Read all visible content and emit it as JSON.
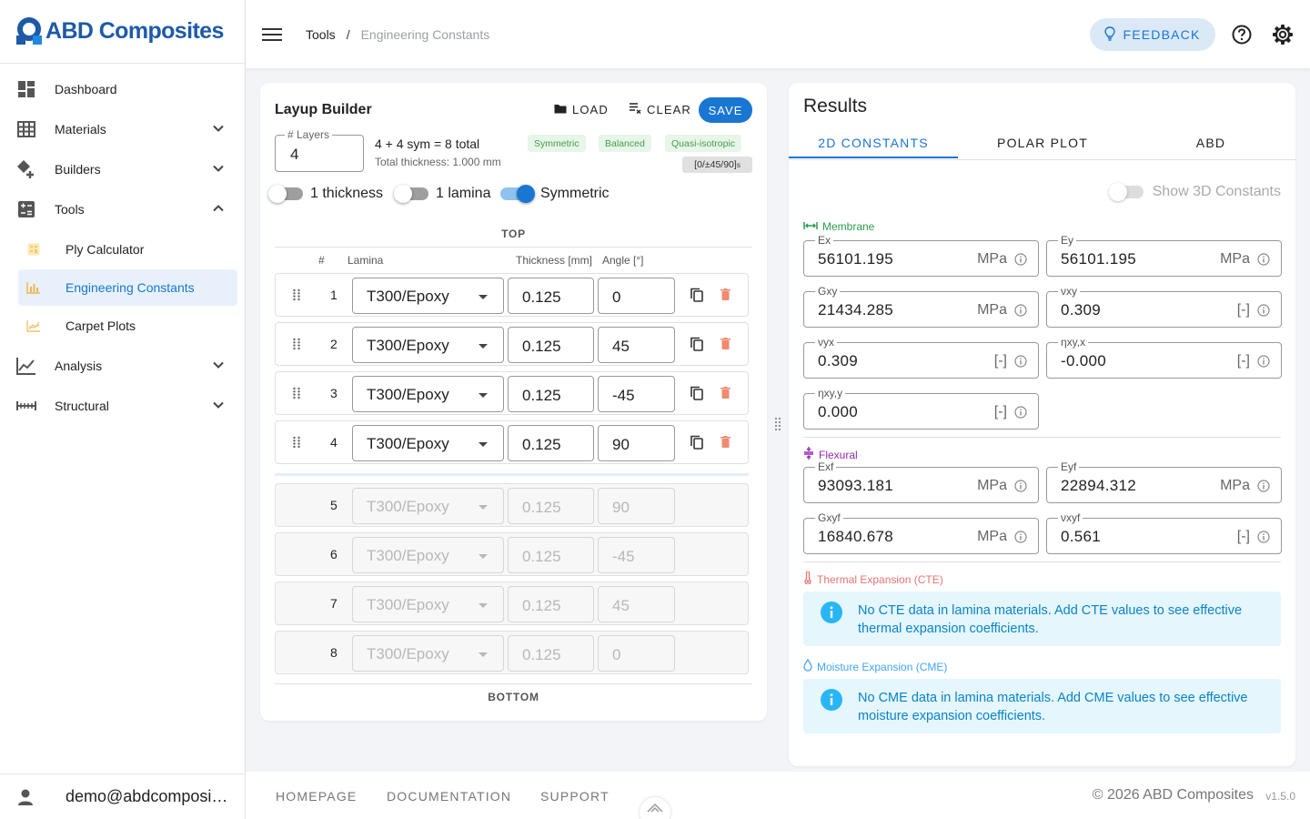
{
  "app": {
    "brand": "ABD Composites"
  },
  "sidebar": {
    "items": [
      {
        "label": "Dashboard",
        "icon": "dashboard-icon"
      },
      {
        "label": "Materials",
        "icon": "grid-table-icon"
      },
      {
        "label": "Builders",
        "icon": "shapes-add-icon"
      },
      {
        "label": "Tools",
        "icon": "calculator-box-icon"
      },
      {
        "label": "Analysis",
        "icon": "line-chart-icon"
      },
      {
        "label": "Structural",
        "icon": "beam-icon"
      }
    ],
    "tools_children": [
      {
        "label": "Ply Calculator",
        "icon": "calculator-icon"
      },
      {
        "label": "Engineering Constants",
        "icon": "bar-chart-icon"
      },
      {
        "label": "Carpet Plots",
        "icon": "carpet-plot-icon"
      }
    ],
    "user_email": "demo@abdcomposites.com"
  },
  "breadcrumb": {
    "root": "Tools",
    "separator": "/",
    "current": "Engineering Constants"
  },
  "topbar": {
    "feedback_label": "FEEDBACK"
  },
  "layup": {
    "title": "Layup Builder",
    "load_label": "LOAD",
    "clear_label": "CLEAR",
    "save_label": "SAVE",
    "layers_label": "# Layers",
    "layers_value": "4",
    "summary": "4 + 4 sym = 8 total",
    "total_thickness": "Total thickness: 1.000 mm",
    "chips": [
      "Symmetric",
      "Balanced",
      "Quasi-isotropic"
    ],
    "code_main": "[0/±45/90]",
    "code_sub": "s",
    "toggles": [
      {
        "label": "1 thickness",
        "on": false
      },
      {
        "label": "1 lamina",
        "on": false
      },
      {
        "label": "Symmetric",
        "on": true
      }
    ],
    "top_label": "TOP",
    "bottom_label": "BOTTOM",
    "col_num": "#",
    "col_lamina": "Lamina",
    "col_thickness": "Thickness [mm]",
    "col_angle": "Angle [°]",
    "rows": [
      {
        "num": "1",
        "lamina": "T300/Epoxy",
        "thickness": "0.125",
        "angle": "0"
      },
      {
        "num": "2",
        "lamina": "T300/Epoxy",
        "thickness": "0.125",
        "angle": "45"
      },
      {
        "num": "3",
        "lamina": "T300/Epoxy",
        "thickness": "0.125",
        "angle": "-45"
      },
      {
        "num": "4",
        "lamina": "T300/Epoxy",
        "thickness": "0.125",
        "angle": "90"
      }
    ],
    "mirror_rows": [
      {
        "num": "5",
        "lamina": "T300/Epoxy",
        "thickness": "0.125",
        "angle": "90"
      },
      {
        "num": "6",
        "lamina": "T300/Epoxy",
        "thickness": "0.125",
        "angle": "-45"
      },
      {
        "num": "7",
        "lamina": "T300/Epoxy",
        "thickness": "0.125",
        "angle": "45"
      },
      {
        "num": "8",
        "lamina": "T300/Epoxy",
        "thickness": "0.125",
        "angle": "0"
      }
    ]
  },
  "results": {
    "title": "Results",
    "tabs": [
      "2D CONSTANTS",
      "POLAR PLOT",
      "ABD"
    ],
    "show3d_label": "Show 3D Constants",
    "membrane_label": "Membrane",
    "membrane": [
      {
        "label": "Ex",
        "value": "56101.195",
        "unit": "MPa"
      },
      {
        "label": "Ey",
        "value": "56101.195",
        "unit": "MPa"
      },
      {
        "label": "Gxy",
        "value": "21434.285",
        "unit": "MPa"
      },
      {
        "label": "νxy",
        "value": "0.309",
        "unit": "[-]"
      },
      {
        "label": "νyx",
        "value": "0.309",
        "unit": "[-]"
      },
      {
        "label": "ηxy,x",
        "value": "-0.000",
        "unit": "[-]"
      },
      {
        "label": "ηxy,y",
        "value": "0.000",
        "unit": "[-]"
      }
    ],
    "flexural_label": "Flexural",
    "flexural": [
      {
        "label": "Exf",
        "value": "93093.181",
        "unit": "MPa"
      },
      {
        "label": "Eyf",
        "value": "22894.312",
        "unit": "MPa"
      },
      {
        "label": "Gxyf",
        "value": "16840.678",
        "unit": "MPa"
      },
      {
        "label": "νxyf",
        "value": "0.561",
        "unit": "[-]"
      }
    ],
    "cte_label": "Thermal Expansion (CTE)",
    "cte_message": "No CTE data in lamina materials. Add CTE values to see effective thermal expansion coefficients.",
    "cme_label": "Moisture Expansion (CME)",
    "cme_message": "No CME data in lamina materials. Add CME values to see effective moisture expansion coefficients."
  },
  "footer": {
    "links": [
      "HOMEPAGE",
      "DOCUMENTATION",
      "SUPPORT"
    ],
    "copyright": "© 2026 ABD Composites",
    "version": "v1.5.0"
  },
  "colors": {
    "primary": "#1976d2",
    "brand": "#1e5aa8",
    "success": "#43a047",
    "delete": "#ef8a6f",
    "info_bg": "#e5f6fd"
  }
}
